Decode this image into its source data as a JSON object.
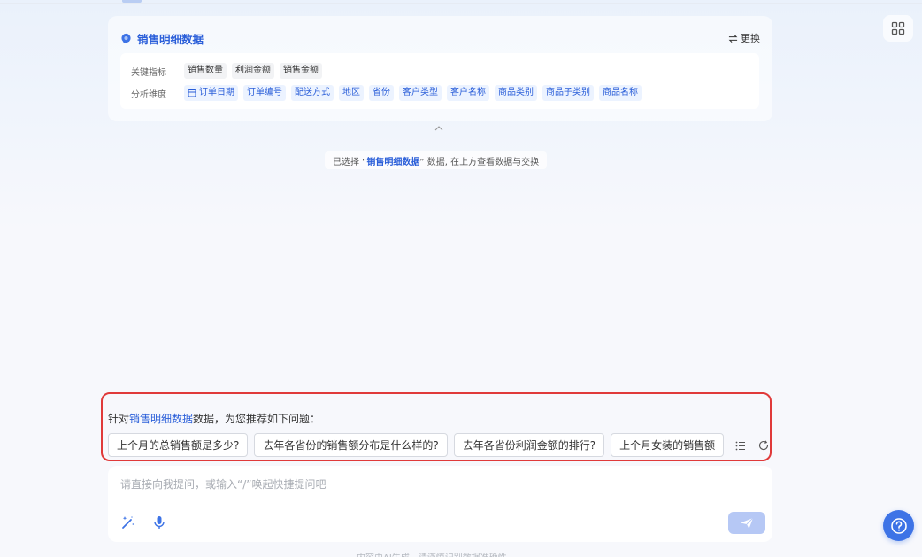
{
  "dataset": {
    "title": "销售明细数据",
    "switch_label": "更换",
    "metrics_label": "关键指标",
    "metrics": [
      "销售数量",
      "利润金额",
      "销售金额"
    ],
    "dimensions_label": "分析维度",
    "dimensions": [
      "订单日期",
      "订单编号",
      "配送方式",
      "地区",
      "省份",
      "客户类型",
      "客户名称",
      "商品类别",
      "商品子类别",
      "商品名称"
    ]
  },
  "selected_info": {
    "prefix": "已选择 “",
    "dataset": "销售明细数据",
    "suffix": "” 数据, 在上方查看数据与交换"
  },
  "suggestions": {
    "title_prefix": "针对",
    "title_dataset": "销售明细数据",
    "title_suffix": "数据，为您推荐如下问题：",
    "questions": [
      "上个月的总销售额是多少?",
      "去年各省份的销售额分布是什么样的?",
      "去年各省份利润金额的排行?",
      "上个月女装的销售额"
    ]
  },
  "input": {
    "placeholder": "请直接向我提问，或输入“/”唤起快捷提问吧"
  },
  "disclaimer": "内容由AI生成，请谨慎识别数据准确性",
  "colors": {
    "accent": "#2b5fd9",
    "highlight_border": "#e03a3a",
    "send_disabled": "#b6c8f5",
    "help_button": "#3d73e6"
  },
  "icons": {
    "apps": "grid-icon",
    "dataset": "chat-bubble-icon",
    "switch": "swap-icon",
    "calendar": "calendar-icon",
    "list": "list-icon",
    "refresh": "refresh-icon",
    "magic": "magic-wand-icon",
    "mic": "microphone-icon",
    "send": "send-icon",
    "help": "help-icon"
  }
}
